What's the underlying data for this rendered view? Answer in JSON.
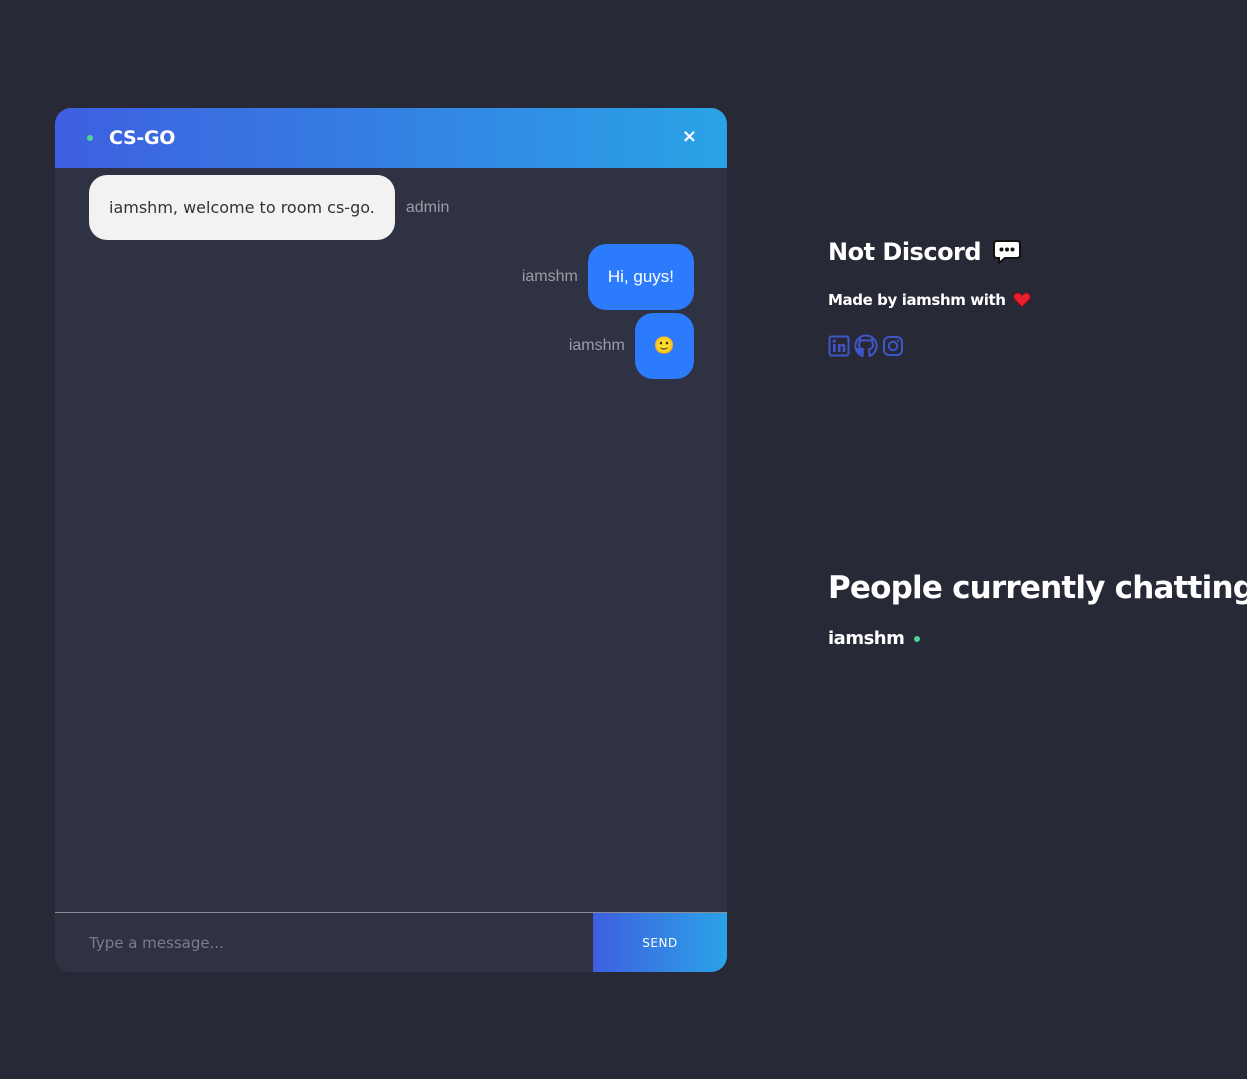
{
  "chat": {
    "room_title": "CS-GO",
    "close_label": "×",
    "messages": [
      {
        "text": "iamshm, welcome to room cs-go.",
        "sender": "admin"
      },
      {
        "text": "Hi, guys!",
        "sender": "iamshm"
      },
      {
        "text": "🙂",
        "sender": "iamshm"
      }
    ],
    "composer": {
      "placeholder": "Type a message...",
      "value": "",
      "send_label": "SEND"
    }
  },
  "sidebar": {
    "app_title": "Not Discord",
    "made_by": "Made by iamshm with",
    "social_icons": [
      "linkedin-icon",
      "github-icon",
      "instagram-icon"
    ],
    "people_title": "People currently chatting:",
    "people": [
      "iamshm"
    ]
  },
  "colors": {
    "background": "#272936",
    "chat_panel": "#2f3242",
    "gradient_start": "#3e5fe0",
    "gradient_end": "#2aa3e6",
    "my_bubble": "#2b7bfc",
    "admin_bubble": "#f2f2f2",
    "online": "#4ed48b",
    "social": "#3f56c9"
  }
}
